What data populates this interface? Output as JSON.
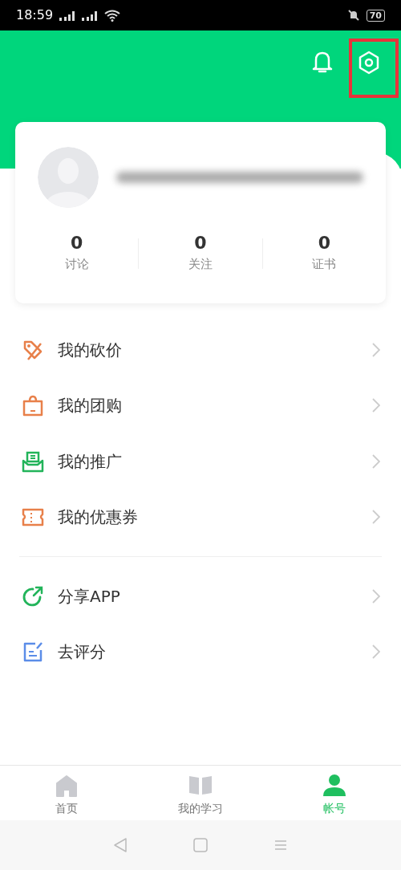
{
  "status_bar": {
    "time": "18:59",
    "battery": "70"
  },
  "header": {
    "settings_highlighted": true
  },
  "profile": {
    "stats": [
      {
        "value": "0",
        "label": "讨论"
      },
      {
        "value": "0",
        "label": "关注"
      },
      {
        "value": "0",
        "label": "证书"
      }
    ]
  },
  "menu_groups": [
    [
      {
        "label": "我的砍价",
        "kind": "tag",
        "color": "#e8804a"
      },
      {
        "label": "我的团购",
        "kind": "bag",
        "color": "#e8804a"
      },
      {
        "label": "我的推广",
        "kind": "inbox",
        "color": "#22b45a"
      },
      {
        "label": "我的优惠券",
        "kind": "ticket",
        "color": "#e8804a"
      }
    ],
    [
      {
        "label": "分享APP",
        "kind": "share",
        "color": "#22b45a"
      },
      {
        "label": "去评分",
        "kind": "rate",
        "color": "#5b8de8"
      }
    ]
  ],
  "tab_bar": [
    {
      "label": "首页",
      "kind": "home",
      "selected": false
    },
    {
      "label": "我的学习",
      "kind": "book",
      "selected": false
    },
    {
      "label": "帐号",
      "kind": "person",
      "selected": true
    }
  ]
}
